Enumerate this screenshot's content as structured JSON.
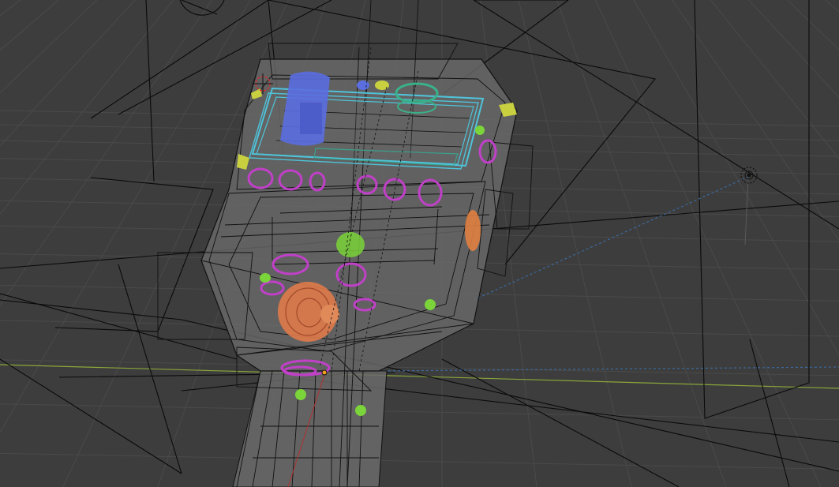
{
  "viewport": {
    "view": "3D Viewport",
    "shading": "wireframe"
  },
  "colors": {
    "background": "#3d3d3d",
    "grid_line": "#4a4a4a",
    "x_axis": "#8aa63a",
    "wire": "#0a0a0a",
    "body_fill": "#6a6a6a",
    "screen_frame": "#4fc3d9",
    "screen_inner": "#3aa08a",
    "button_magenta": "#c040c8",
    "button_green": "#7ad43a",
    "knob_orange": "#e07a4a",
    "side_orange": "#e08040",
    "blue_part": "#5a6ee0",
    "teal_part": "#3ab08a",
    "yellow_marker": "#c8d040",
    "cursor_red": "#d03030",
    "light_dash": "#3a6aa0"
  },
  "objects": [
    {
      "name": "remote-body",
      "type": "mesh"
    },
    {
      "name": "screen",
      "type": "mesh"
    },
    {
      "name": "buttons",
      "type": "mesh"
    },
    {
      "name": "dial-knob",
      "type": "mesh"
    },
    {
      "name": "camera",
      "type": "camera"
    },
    {
      "name": "light",
      "type": "light"
    }
  ]
}
